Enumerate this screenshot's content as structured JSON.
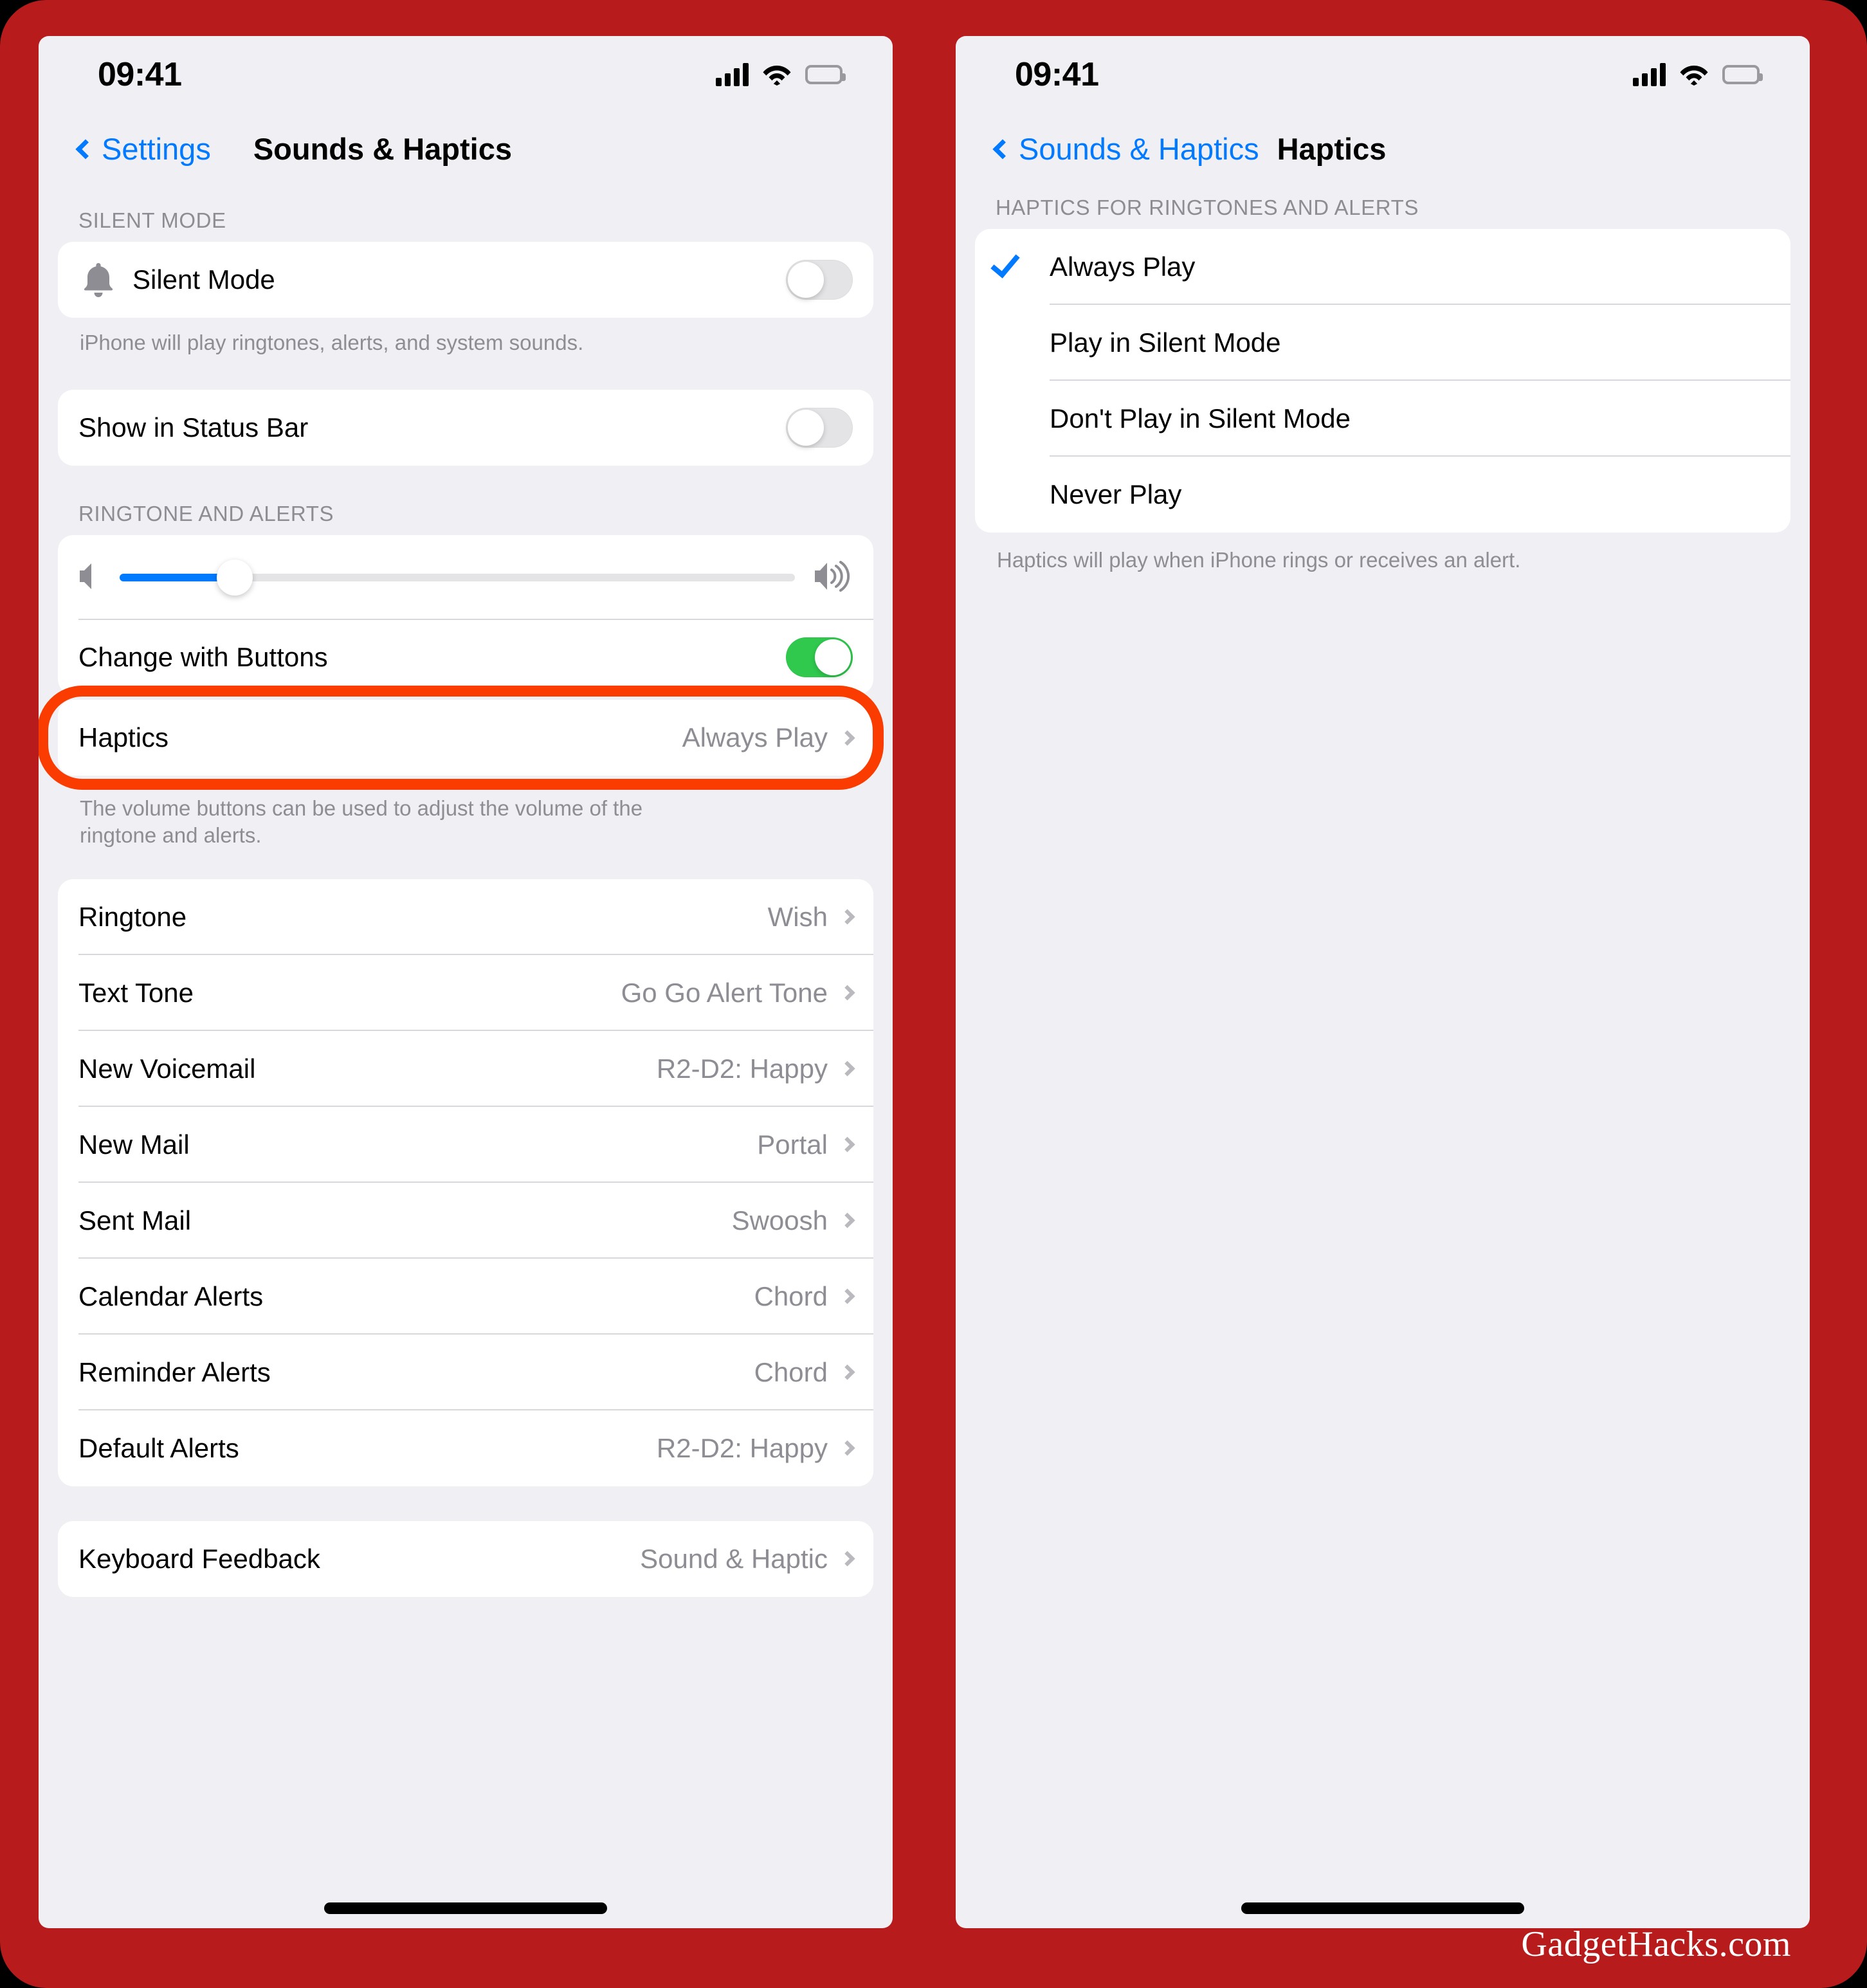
{
  "brand": {
    "accent_blue": "#027AFF",
    "accent_green": "#30C94E",
    "frame_red": "#B81B1C",
    "highlight_orange": "#FA3C00"
  },
  "watermark": "GadgetHacks.com",
  "left": {
    "status": {
      "time": "09:41",
      "signal_icon": "cellular-bars-icon",
      "wifi_icon": "wifi-icon",
      "battery_icon": "battery-full-icon"
    },
    "nav": {
      "back_label": "Settings",
      "title": "Sounds & Haptics"
    },
    "silent_section": {
      "header": "SILENT MODE",
      "row_label": "Silent Mode",
      "row_icon": "bell-icon",
      "toggle_state": "off",
      "footnote": "iPhone will play ringtones, alerts, and system sounds."
    },
    "status_bar_section": {
      "row_label": "Show in Status Bar",
      "toggle_state": "off"
    },
    "ringtone_section": {
      "header": "RINGTONE AND ALERTS",
      "slider": {
        "value_percent": 17,
        "left_icon": "speaker-low-icon",
        "right_icon": "speaker-high-icon"
      },
      "change_with_buttons": {
        "label": "Change with Buttons",
        "toggle_state": "on"
      },
      "haptics": {
        "label": "Haptics",
        "value": "Always Play",
        "highlighted": true
      },
      "footnote": "The volume buttons can be used to adjust the volume of the ringtone and alerts."
    },
    "tones": [
      {
        "label": "Ringtone",
        "value": "Wish"
      },
      {
        "label": "Text Tone",
        "value": "Go Go Alert Tone"
      },
      {
        "label": "New Voicemail",
        "value": "R2-D2: Happy"
      },
      {
        "label": "New Mail",
        "value": "Portal"
      },
      {
        "label": "Sent Mail",
        "value": "Swoosh"
      },
      {
        "label": "Calendar Alerts",
        "value": "Chord"
      },
      {
        "label": "Reminder Alerts",
        "value": "Chord"
      },
      {
        "label": "Default Alerts",
        "value": "R2-D2: Happy"
      }
    ],
    "keyboard": [
      {
        "label": "Keyboard Feedback",
        "value": "Sound & Haptic"
      }
    ]
  },
  "right": {
    "status": {
      "time": "09:41",
      "signal_icon": "cellular-bars-icon",
      "wifi_icon": "wifi-icon",
      "battery_icon": "battery-full-icon"
    },
    "nav": {
      "back_label": "Sounds & Haptics",
      "title": "Haptics"
    },
    "section": {
      "header": "HAPTICS FOR RINGTONES AND ALERTS",
      "options": [
        {
          "label": "Always Play",
          "selected": true
        },
        {
          "label": "Play in Silent Mode",
          "selected": false
        },
        {
          "label": "Don't Play in Silent Mode",
          "selected": false
        },
        {
          "label": "Never Play",
          "selected": false
        }
      ],
      "footnote": "Haptics will play when iPhone rings or receives an alert."
    }
  }
}
